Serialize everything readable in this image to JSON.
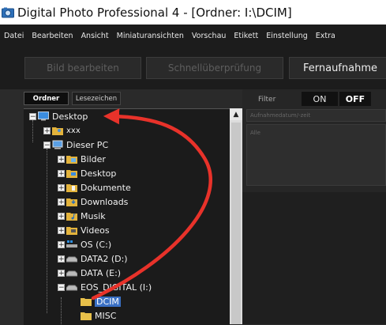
{
  "window": {
    "title": "Digital Photo Professional 4 - [Ordner: I:\\DCIM]"
  },
  "menu": [
    "Datei",
    "Bearbeiten",
    "Ansicht",
    "Miniaturansichten",
    "Vorschau",
    "Etikett",
    "Einstellung",
    "Extra"
  ],
  "toolbar": {
    "edit_label": "Bild bearbeiten",
    "quickcheck_label": "Schnellüberprüfung",
    "remote_label": "Fernaufnahme"
  },
  "tabs": {
    "folder": "Ordner",
    "bookmarks": "Lesezeichen"
  },
  "tree": [
    {
      "label": "Desktop",
      "icon": "desktop-icon"
    },
    {
      "label": "xxx",
      "icon": "user-folder-icon"
    },
    {
      "label": "Dieser PC",
      "icon": "computer-icon"
    },
    {
      "label": "Bilder",
      "icon": "pictures-folder-icon"
    },
    {
      "label": "Desktop",
      "icon": "desktop-folder-icon"
    },
    {
      "label": "Dokumente",
      "icon": "documents-folder-icon"
    },
    {
      "label": "Downloads",
      "icon": "downloads-folder-icon"
    },
    {
      "label": "Musik",
      "icon": "music-folder-icon"
    },
    {
      "label": "Videos",
      "icon": "videos-folder-icon"
    },
    {
      "label": "OS (C:)",
      "icon": "os-drive-icon"
    },
    {
      "label": "DATA2 (D:)",
      "icon": "drive-icon"
    },
    {
      "label": "DATA (E:)",
      "icon": "drive-icon"
    },
    {
      "label": "EOS_DIGITAL (I:)",
      "icon": "removable-drive-icon"
    },
    {
      "label": "DCIM",
      "icon": "folder-icon",
      "selected": true
    },
    {
      "label": "MISC",
      "icon": "folder-icon"
    }
  ],
  "filter": {
    "label": "Filter",
    "on": "ON",
    "off": "OFF",
    "active": "OFF"
  },
  "filter_fields": {
    "date_placeholder": "Aufnahmedatum/-zeit",
    "all_value": "Alle"
  },
  "colors": {
    "selection": "#3a70c4",
    "arrow": "#e8322a",
    "background": "#2b2b2b"
  }
}
